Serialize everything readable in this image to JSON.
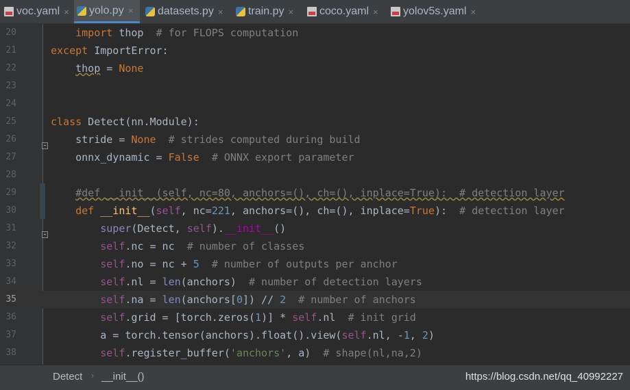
{
  "tabs": [
    {
      "label": "voc.yaml",
      "type": "yaml",
      "active": false
    },
    {
      "label": "yolo.py",
      "type": "python",
      "active": true
    },
    {
      "label": "datasets.py",
      "type": "python",
      "active": false
    },
    {
      "label": "train.py",
      "type": "python",
      "active": false
    },
    {
      "label": "coco.yaml",
      "type": "yaml",
      "active": false
    },
    {
      "label": "yolov5s.yaml",
      "type": "yaml",
      "active": false
    }
  ],
  "tab_close_glyph": "×",
  "current_line": 35,
  "lines": [
    {
      "no": "20",
      "tokens": [
        [
          "    ",
          ""
        ],
        [
          "import",
          "kw"
        ],
        [
          " thop  ",
          ""
        ],
        [
          "# for FLOPS computation",
          "cm"
        ]
      ]
    },
    {
      "no": "21",
      "tokens": [
        [
          "except",
          "kw"
        ],
        [
          " ImportError:",
          ""
        ]
      ]
    },
    {
      "no": "22",
      "tokens": [
        [
          "    ",
          ""
        ],
        [
          "thop",
          "wavy"
        ],
        [
          " = ",
          ""
        ],
        [
          "None",
          "kw"
        ]
      ]
    },
    {
      "no": "23",
      "tokens": []
    },
    {
      "no": "24",
      "tokens": []
    },
    {
      "no": "25",
      "tokens": [
        [
          "class",
          "kw"
        ],
        [
          " Detect(nn.Module):",
          ""
        ]
      ]
    },
    {
      "no": "26",
      "tokens": [
        [
          "    stride = ",
          ""
        ],
        [
          "None",
          "kw"
        ],
        [
          "  ",
          ""
        ],
        [
          "# strides computed during build",
          "cm"
        ]
      ]
    },
    {
      "no": "27",
      "tokens": [
        [
          "    onnx_dynamic = ",
          ""
        ],
        [
          "False",
          "kw"
        ],
        [
          "  ",
          ""
        ],
        [
          "# ONNX export parameter",
          "cm"
        ]
      ]
    },
    {
      "no": "28",
      "tokens": []
    },
    {
      "no": "29",
      "tokens": [
        [
          "    ",
          ""
        ],
        [
          "#def __init__(self, nc=80, anchors=(), ch=(), inplace=True):  # detection layer",
          "cm wavy"
        ]
      ]
    },
    {
      "no": "30",
      "tokens": [
        [
          "    ",
          ""
        ],
        [
          "def ",
          "kw"
        ],
        [
          "__init__",
          "cls"
        ],
        [
          "(",
          ""
        ],
        [
          "self",
          "sl"
        ],
        [
          ", nc=",
          ""
        ],
        [
          "221",
          "nm"
        ],
        [
          ", anchors=(), ch=(), inplace=",
          ""
        ],
        [
          "True",
          "kw"
        ],
        [
          "):  ",
          ""
        ],
        [
          "# detection layer",
          "cm"
        ]
      ]
    },
    {
      "no": "31",
      "tokens": [
        [
          "        ",
          ""
        ],
        [
          "super",
          "fn"
        ],
        [
          "(Detect, ",
          ""
        ],
        [
          "self",
          "sl"
        ],
        [
          ").",
          ""
        ],
        [
          "__init__",
          "dn"
        ],
        [
          "()",
          ""
        ]
      ]
    },
    {
      "no": "32",
      "tokens": [
        [
          "        ",
          ""
        ],
        [
          "self",
          "sl"
        ],
        [
          ".nc = nc  ",
          ""
        ],
        [
          "# number of classes",
          "cm"
        ]
      ]
    },
    {
      "no": "33",
      "tokens": [
        [
          "        ",
          ""
        ],
        [
          "self",
          "sl"
        ],
        [
          ".no = nc + ",
          ""
        ],
        [
          "5",
          "nm"
        ],
        [
          "  ",
          ""
        ],
        [
          "# number of outputs per anchor",
          "cm"
        ]
      ]
    },
    {
      "no": "34",
      "tokens": [
        [
          "        ",
          ""
        ],
        [
          "self",
          "sl"
        ],
        [
          ".nl = ",
          ""
        ],
        [
          "len",
          "fn"
        ],
        [
          "(anchors)  ",
          ""
        ],
        [
          "# number of detection layers",
          "cm"
        ]
      ]
    },
    {
      "no": "35",
      "tokens": [
        [
          "        ",
          ""
        ],
        [
          "self",
          "sl"
        ],
        [
          ".na = ",
          ""
        ],
        [
          "len",
          "fn"
        ],
        [
          "(anchors[",
          ""
        ],
        [
          "0",
          "nm"
        ],
        [
          "]) // ",
          ""
        ],
        [
          "2",
          "nm"
        ],
        [
          "  ",
          ""
        ],
        [
          "# number of anchors",
          "cm"
        ]
      ]
    },
    {
      "no": "36",
      "tokens": [
        [
          "        ",
          ""
        ],
        [
          "self",
          "sl"
        ],
        [
          ".grid = [torch.zeros(",
          ""
        ],
        [
          "1",
          "nm"
        ],
        [
          ")] * ",
          ""
        ],
        [
          "self",
          "sl"
        ],
        [
          ".nl  ",
          ""
        ],
        [
          "# init grid",
          "cm"
        ]
      ]
    },
    {
      "no": "37",
      "tokens": [
        [
          "        a = torch.tensor(anchors).float().view(",
          ""
        ],
        [
          "self",
          "sl"
        ],
        [
          ".nl, -",
          ""
        ],
        [
          "1",
          "nm"
        ],
        [
          ", ",
          ""
        ],
        [
          "2",
          "nm"
        ],
        [
          ")",
          ""
        ]
      ]
    },
    {
      "no": "38",
      "tokens": [
        [
          "        ",
          ""
        ],
        [
          "self",
          "sl"
        ],
        [
          ".register_buffer(",
          ""
        ],
        [
          "'anchors'",
          "st"
        ],
        [
          ", a)  ",
          ""
        ],
        [
          "# shape(nl,na,2)",
          "cm"
        ]
      ]
    }
  ],
  "breadcrumb": [
    "Detect",
    "__init__()"
  ],
  "breadcrumb_sep": "›",
  "watermark": "https://blog.csdn.net/qq_40992227"
}
